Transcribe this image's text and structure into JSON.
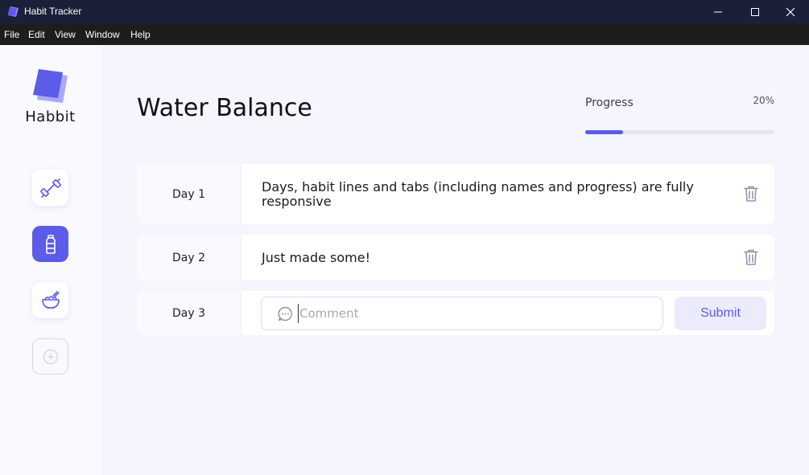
{
  "window": {
    "title": "Habit Tracker",
    "minimize_icon": "minimize-icon",
    "maximize_icon": "maximize-icon",
    "close_icon": "close-icon"
  },
  "menu": [
    "File",
    "Edit",
    "View",
    "Window",
    "Help"
  ],
  "sidebar": {
    "logo_text": "Habbit",
    "items": [
      {
        "icon": "dumbbell-icon",
        "active": false
      },
      {
        "icon": "water-bottle-icon",
        "active": true
      },
      {
        "icon": "food-bowl-icon",
        "active": false
      },
      {
        "icon": "add-circle-icon",
        "active": false
      }
    ]
  },
  "habit": {
    "title": "Water Balance",
    "progress_label": "Progress",
    "progress_value": "20%",
    "progress_fraction": 0.2
  },
  "days": [
    {
      "label": "Day 1",
      "text": "Days, habit lines and tabs (including names and progress) are fully responsive"
    },
    {
      "label": "Day 2",
      "text": "Just made some!"
    },
    {
      "label": "Day 3",
      "comment_placeholder": "Comment",
      "submit_label": "Submit"
    }
  ],
  "colors": {
    "accent": "#5b5ce8",
    "titlebar": "#1a2037",
    "menubar": "#1d1d1d",
    "background": "#f4f5fd"
  }
}
